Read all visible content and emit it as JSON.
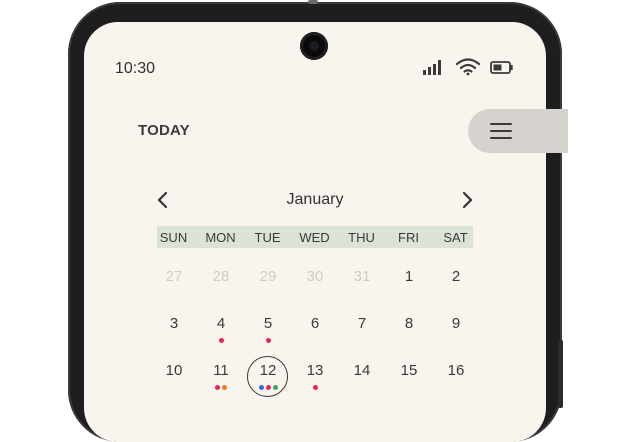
{
  "status_bar": {
    "time": "10:30",
    "icons": [
      "cellular-signal-icon",
      "wifi-icon",
      "battery-icon"
    ]
  },
  "header": {
    "today_label": "TODAY",
    "menu_icon": "hamburger-menu-icon"
  },
  "calendar": {
    "month": "January",
    "weekdays": [
      "SUN",
      "MON",
      "TUE",
      "WED",
      "THU",
      "FRI",
      "SAT"
    ],
    "weeks": [
      [
        {
          "day": "27",
          "muted": true,
          "dots": []
        },
        {
          "day": "28",
          "muted": true,
          "dots": []
        },
        {
          "day": "29",
          "muted": true,
          "dots": []
        },
        {
          "day": "30",
          "muted": true,
          "dots": []
        },
        {
          "day": "31",
          "muted": true,
          "dots": []
        },
        {
          "day": "1",
          "muted": false,
          "dots": []
        },
        {
          "day": "2",
          "muted": false,
          "dots": []
        }
      ],
      [
        {
          "day": "3",
          "muted": false,
          "dots": []
        },
        {
          "day": "4",
          "muted": false,
          "dots": [
            "#e8245f"
          ]
        },
        {
          "day": "5",
          "muted": false,
          "dots": [
            "#e8245f"
          ]
        },
        {
          "day": "6",
          "muted": false,
          "dots": []
        },
        {
          "day": "7",
          "muted": false,
          "dots": []
        },
        {
          "day": "8",
          "muted": false,
          "dots": []
        },
        {
          "day": "9",
          "muted": false,
          "dots": []
        }
      ],
      [
        {
          "day": "10",
          "muted": false,
          "dots": []
        },
        {
          "day": "11",
          "muted": false,
          "dots": [
            "#e8245f",
            "#f07a1a"
          ]
        },
        {
          "day": "12",
          "muted": false,
          "today": true,
          "dots": [
            "#2f6fd6",
            "#e8245f",
            "#3aa655"
          ]
        },
        {
          "day": "13",
          "muted": false,
          "dots": [
            "#e8245f"
          ]
        },
        {
          "day": "14",
          "muted": false,
          "dots": []
        },
        {
          "day": "15",
          "muted": false,
          "dots": []
        },
        {
          "day": "16",
          "muted": false,
          "dots": []
        }
      ]
    ]
  },
  "colors": {
    "screen_background": "#f8f4ee",
    "weekday_bar": "#dbe3d6",
    "menu_pill": "#d6d3ce",
    "event_pink": "#e8245f",
    "event_orange": "#f07a1a",
    "event_blue": "#2f6fd6",
    "event_green": "#3aa655"
  }
}
